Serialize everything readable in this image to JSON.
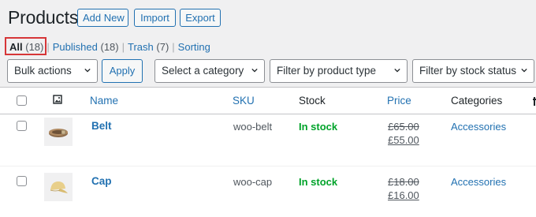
{
  "header": {
    "title": "Products",
    "add_new": "Add New",
    "import": "Import",
    "export": "Export"
  },
  "views": {
    "all": {
      "label": "All",
      "count": "(18)"
    },
    "published": {
      "label": "Published",
      "count": "(18)"
    },
    "trash": {
      "label": "Trash",
      "count": "(7)"
    },
    "sorting": {
      "label": "Sorting"
    },
    "separator": "|"
  },
  "filters": {
    "bulk_actions": "Bulk actions",
    "apply": "Apply",
    "category": "Select a category",
    "product_type": "Filter by product type",
    "stock_status": "Filter by stock status"
  },
  "columns": {
    "name": "Name",
    "sku": "SKU",
    "stock": "Stock",
    "price": "Price",
    "categories": "Categories"
  },
  "rows": [
    {
      "name": "Belt",
      "sku": "woo-belt",
      "stock": "In stock",
      "regular_price": "£65.00",
      "sale_price": "£55.00",
      "category": "Accessories"
    },
    {
      "name": "Cap",
      "sku": "woo-cap",
      "stock": "In stock",
      "regular_price": "£18.00",
      "sale_price": "£16.00",
      "category": "Accessories"
    }
  ],
  "colors": {
    "link": "#2271b1",
    "in_stock": "#00a32a",
    "highlight": "#d63638"
  }
}
